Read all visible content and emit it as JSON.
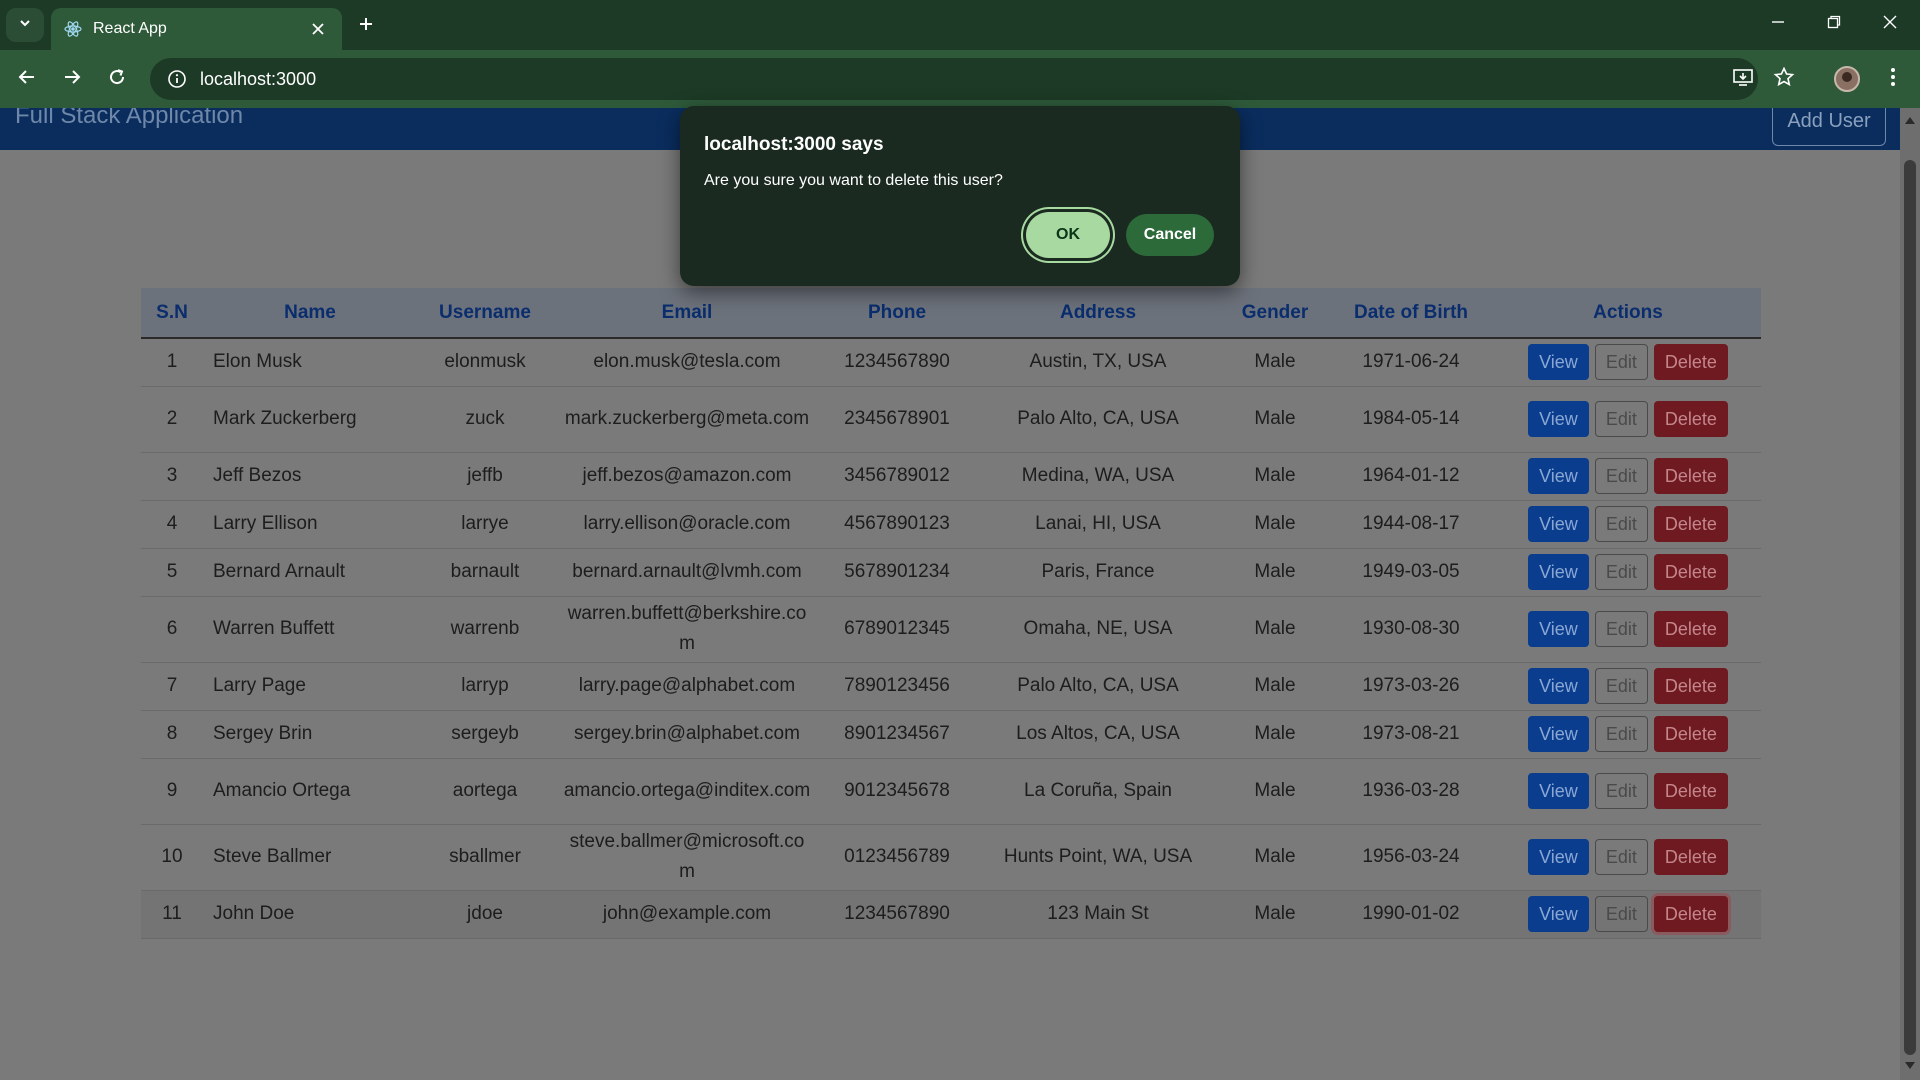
{
  "browser": {
    "tab_title": "React App",
    "url": "localhost:3000"
  },
  "app": {
    "title": "Full Stack Application",
    "add_user_label": "Add User"
  },
  "dialog": {
    "title": "localhost:3000 says",
    "message": "Are you sure you want to delete this user?",
    "ok_label": "OK",
    "cancel_label": "Cancel"
  },
  "table": {
    "headers": [
      "S.N",
      "Name",
      "Username",
      "Email",
      "Phone",
      "Address",
      "Gender",
      "Date of Birth",
      "Actions"
    ],
    "action_labels": {
      "view": "View",
      "edit": "Edit",
      "delete": "Delete"
    },
    "rows": [
      {
        "sn": "1",
        "name": "Elon Musk",
        "username": "elonmusk",
        "email": "elon.musk@tesla.com",
        "phone": "1234567890",
        "address": "Austin, TX, USA",
        "gender": "Male",
        "dob": "1971-06-24"
      },
      {
        "sn": "2",
        "name": "Mark Zuckerberg",
        "username": "zuck",
        "email": "mark.zuckerberg@meta.com",
        "phone": "2345678901",
        "address": "Palo Alto, CA, USA",
        "gender": "Male",
        "dob": "1984-05-14"
      },
      {
        "sn": "3",
        "name": "Jeff Bezos",
        "username": "jeffb",
        "email": "jeff.bezos@amazon.com",
        "phone": "3456789012",
        "address": "Medina, WA, USA",
        "gender": "Male",
        "dob": "1964-01-12"
      },
      {
        "sn": "4",
        "name": "Larry Ellison",
        "username": "larrye",
        "email": "larry.ellison@oracle.com",
        "phone": "4567890123",
        "address": "Lanai, HI, USA",
        "gender": "Male",
        "dob": "1944-08-17"
      },
      {
        "sn": "5",
        "name": "Bernard Arnault",
        "username": "barnault",
        "email": "bernard.arnault@lvmh.com",
        "phone": "5678901234",
        "address": "Paris, France",
        "gender": "Male",
        "dob": "1949-03-05"
      },
      {
        "sn": "6",
        "name": "Warren Buffett",
        "username": "warrenb",
        "email": "warren.buffett@berkshire.com",
        "phone": "6789012345",
        "address": "Omaha, NE, USA",
        "gender": "Male",
        "dob": "1930-08-30"
      },
      {
        "sn": "7",
        "name": "Larry Page",
        "username": "larryp",
        "email": "larry.page@alphabet.com",
        "phone": "7890123456",
        "address": "Palo Alto, CA, USA",
        "gender": "Male",
        "dob": "1973-03-26"
      },
      {
        "sn": "8",
        "name": "Sergey Brin",
        "username": "sergeyb",
        "email": "sergey.brin@alphabet.com",
        "phone": "8901234567",
        "address": "Los Altos, CA, USA",
        "gender": "Male",
        "dob": "1973-08-21"
      },
      {
        "sn": "9",
        "name": "Amancio Ortega",
        "username": "aortega",
        "email": "amancio.ortega@inditex.com",
        "phone": "9012345678",
        "address": "La Coruña, Spain",
        "gender": "Male",
        "dob": "1936-03-28"
      },
      {
        "sn": "10",
        "name": "Steve Ballmer",
        "username": "sballmer",
        "email": "steve.ballmer@microsoft.com",
        "phone": "0123456789",
        "address": "Hunts Point, WA, USA",
        "gender": "Male",
        "dob": "1956-03-24"
      },
      {
        "sn": "11",
        "name": "John Doe",
        "username": "jdoe",
        "email": "john@example.com",
        "phone": "1234567890",
        "address": "123 Main St",
        "gender": "Male",
        "dob": "1990-01-02"
      }
    ]
  }
}
